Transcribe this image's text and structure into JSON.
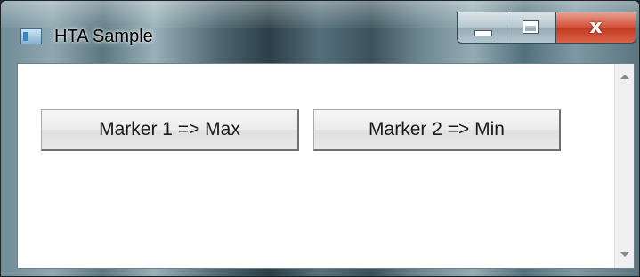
{
  "window": {
    "title": "HTA Sample",
    "close_glyph": "x"
  },
  "buttons": [
    {
      "label": "Marker 1 => Max"
    },
    {
      "label": "Marker 2 => Min"
    }
  ],
  "icons": {
    "app": "hta-app-icon",
    "minimize": "minimize-icon",
    "maximize": "maximize-icon",
    "close": "close-icon",
    "scroll_up": "scroll-up-arrow-icon",
    "scroll_down": "scroll-down-arrow-icon"
  },
  "colors": {
    "close_button": "#d5513a",
    "client_background": "#ffffff"
  }
}
